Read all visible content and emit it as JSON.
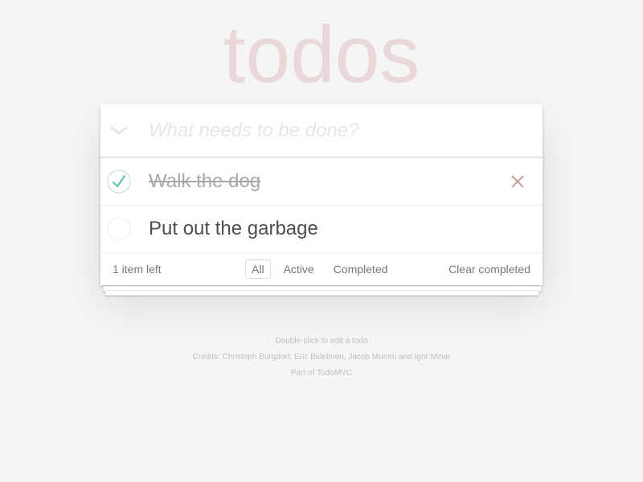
{
  "app": {
    "title": "todos"
  },
  "new_todo": {
    "placeholder": "What needs to be done?",
    "value": ""
  },
  "todos": [
    {
      "label": "Walk the dog",
      "completed": true
    },
    {
      "label": "Put out the garbage",
      "completed": false
    }
  ],
  "footer": {
    "count_text": "1 item left",
    "filters": [
      {
        "label": "All",
        "selected": true
      },
      {
        "label": "Active",
        "selected": false
      },
      {
        "label": "Completed",
        "selected": false
      }
    ],
    "clear_completed_label": "Clear completed"
  },
  "info": {
    "hint": "Double-click to edit a todo",
    "credits": "Credits: Christoph Burgdorf, Eric Bidelman, Jacob Mumm and Igor Minar",
    "part_of": "Part of TodoMVC"
  },
  "icons": {
    "toggle_all": "chevron-down-icon",
    "completed_check": "check-icon",
    "destroy": "close-icon"
  },
  "colors": {
    "background": "#f5f5f5",
    "title": "#e9d7d7",
    "check": "#5dc2af",
    "destroy": "#cc9a9a",
    "text": "#4d4d4d",
    "muted": "#777777"
  }
}
